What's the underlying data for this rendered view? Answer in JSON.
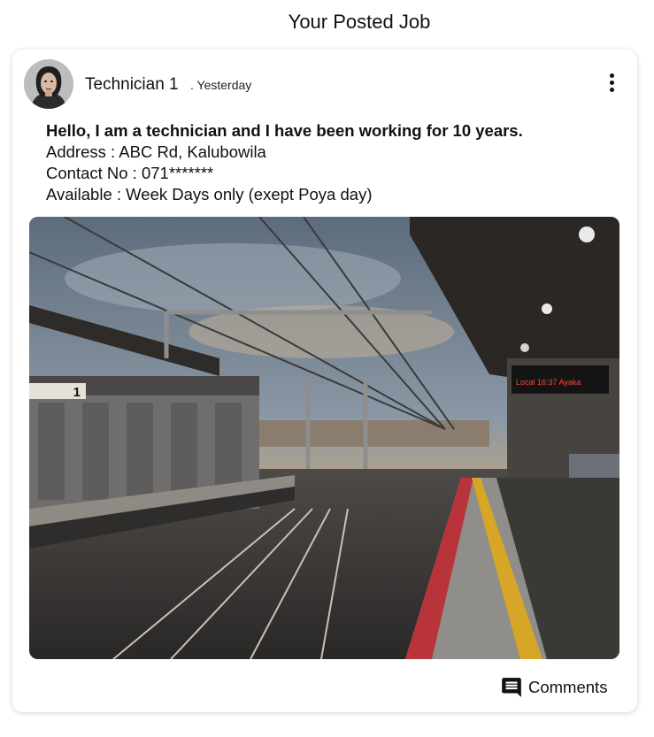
{
  "page": {
    "title": "Your Posted Job"
  },
  "post": {
    "author": "Technician 1",
    "timestamp": ". Yesterday",
    "headline": "Hello, I am a technician and I have been working for 10 years.",
    "address": "Address : ABC Rd, Kalubowila",
    "contact": "Contact No : 071*******",
    "availability": "Available : Week Days only (exept Poya day)",
    "photo_sign": "1",
    "photo_board_text": "Local 16:37 Ayaka",
    "comments_label": "Comments"
  },
  "icons": {
    "more": "more-vertical-icon",
    "comments": "comment-icon"
  },
  "colors": {
    "accent": "#111111",
    "platform_red": "#b9343a",
    "tactile_yellow": "#d8a626"
  }
}
